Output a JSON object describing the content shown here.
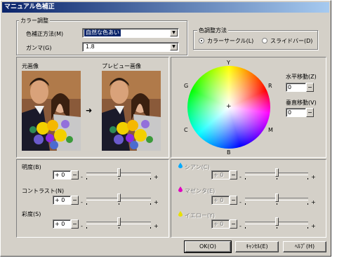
{
  "window": {
    "title": "マニュアル色補正"
  },
  "color_adjust": {
    "group_label": "カラー調整",
    "method_label": "色補正方法(M)",
    "method_value": "自然な色あい",
    "gamma_label": "ガンマ(G)",
    "gamma_value": "1.8"
  },
  "adjust_method": {
    "group_label": "色調整方法",
    "options": [
      {
        "label": "カラーサークル(L)",
        "selected": true
      },
      {
        "label": "スライドバー(D)",
        "selected": false
      }
    ]
  },
  "preview": {
    "original_label": "元画像",
    "preview_label": "プレビュー画像",
    "arrow": "➜"
  },
  "color_circle": {
    "labels": {
      "top": "Y",
      "left_top": "G",
      "right_top": "R",
      "left_bottom": "C",
      "right_bottom": "M",
      "bottom": "B"
    },
    "horizontal_label": "水平移動(Z)",
    "horizontal_value": "0",
    "vertical_label": "垂直移動(V)",
    "vertical_value": "0"
  },
  "left_sliders": [
    {
      "label": "明度(B)",
      "value": "+ 0",
      "minus": "-",
      "plus": "+",
      "position": 0.5
    },
    {
      "label": "コントラスト(N)",
      "value": "+ 0",
      "minus": "-",
      "plus": "+",
      "position": 0.5
    },
    {
      "label": "彩度(S)",
      "value": "+ 0",
      "minus": "-",
      "plus": "+",
      "position": 0.5
    }
  ],
  "right_sliders": [
    {
      "label": "シアン(C)",
      "value": "+ 0",
      "minus": "-",
      "plus": "+",
      "position": 0.5,
      "color": "#00aaff"
    },
    {
      "label": "マゼンタ(E)",
      "value": "+ 0",
      "minus": "-",
      "plus": "+",
      "position": 0.5,
      "color": "#e000c0"
    },
    {
      "label": "イエロー(Y)",
      "value": "+ 0",
      "minus": "-",
      "plus": "+",
      "position": 0.5,
      "color": "#e8e000"
    }
  ],
  "buttons": {
    "ok": "OK(O)",
    "cancel": "ｷｬﾝｾﾙ(E)",
    "help": "ﾍﾙﾌﾟ(H)"
  }
}
